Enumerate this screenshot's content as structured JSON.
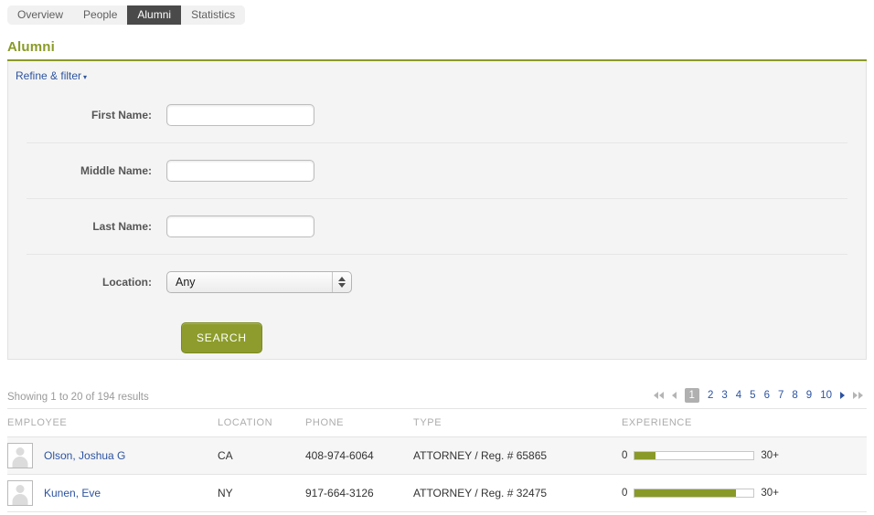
{
  "tabs": [
    {
      "label": "Overview",
      "active": false
    },
    {
      "label": "People",
      "active": false
    },
    {
      "label": "Alumni",
      "active": true
    },
    {
      "label": "Statistics",
      "active": false
    }
  ],
  "page": {
    "title": "Alumni",
    "accent_color": "#8a9a28",
    "link_color": "#2c53a0"
  },
  "filter_panel": {
    "refine_label": "Refine & filter",
    "caret": "▾",
    "fields": [
      {
        "label": "First Name:",
        "value": "",
        "placeholder": ""
      },
      {
        "label": "Middle Name:",
        "value": "",
        "placeholder": ""
      },
      {
        "label": "Last Name:",
        "value": "",
        "placeholder": ""
      }
    ],
    "location": {
      "label": "Location:",
      "selected": "Any",
      "options": [
        "Any"
      ]
    },
    "search_button": "SEARCH"
  },
  "results": {
    "showing": "Showing 1 to 20 of 194 results",
    "pagination": {
      "first": "◀◀",
      "prev": "◀",
      "pages": [
        "1",
        "2",
        "3",
        "4",
        "5",
        "6",
        "7",
        "8",
        "9",
        "10"
      ],
      "current": "1",
      "next": "▶",
      "last": "▶▶"
    },
    "columns": [
      "EMPLOYEE",
      "LOCATION",
      "PHONE",
      "TYPE",
      "EXPERIENCE"
    ],
    "experience_scale": {
      "min": "0",
      "max": "30+"
    },
    "rows": [
      {
        "name": "Olson, Joshua G",
        "location": "CA",
        "phone": "408-974-6064",
        "type": "ATTORNEY / Reg. # 65865",
        "experience_percent": 17
      },
      {
        "name": "Kunen, Eve",
        "location": "NY",
        "phone": "917-664-3126",
        "type": "ATTORNEY / Reg. # 32475",
        "experience_percent": 85
      }
    ]
  }
}
